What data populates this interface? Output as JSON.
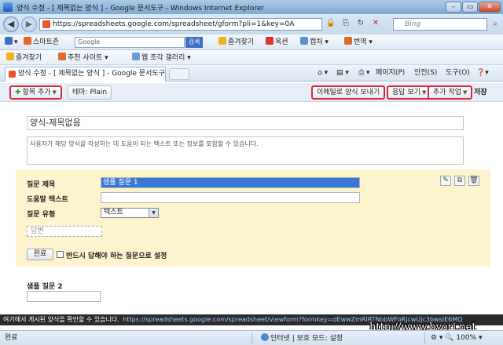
{
  "window": {
    "title": "양식 수정 - [ 제목없는 양식 ] - Google 문서도구 - Windows Internet Explorer",
    "min": "–",
    "max": "▭",
    "close": "✕"
  },
  "address": {
    "url": "https://spreadsheets.google.com/spreadsheet/gform?pli=1&key=0A",
    "search_placeholder": "Bing"
  },
  "google_toolbar": {
    "smartzone": "스마트존",
    "search_value": "Google",
    "search_button": "검색",
    "bookmarks": "즐겨찾기",
    "extras": "옥션",
    "capture": "캡처",
    "translate": "번역"
  },
  "favorites": {
    "favorites": "즐겨찾기",
    "suggested": "추천 사이트",
    "gallery": "웹 조각 갤러리"
  },
  "tabs": {
    "active": "양식 수정 - [ 제목없는 양식 ] - Google 문서도구",
    "page_menu": "페이지(P)",
    "safety_menu": "안전(S)",
    "tools_menu": "도구(O)"
  },
  "app_toolbar": {
    "add_item": "항목 추가",
    "theme": "테마: Plain",
    "email_form": "이메일로 양식 보내기",
    "view_responses": "응답 보기",
    "more_actions": "추가 작업",
    "save": "저장"
  },
  "form": {
    "title": "양식-제목없음",
    "description": "사용자가 해당 양식을 작성하는 데 도움이 되는 텍스트 또는 정보를 포함할 수 있습니다.",
    "question": {
      "title_label": "질문 제목",
      "title_value": "샘플 질문 1",
      "help_label": "도움말 텍스트",
      "type_label": "질문 유형",
      "type_value": "텍스트",
      "answer_placeholder": "답변",
      "done_button": "완료",
      "required_label": "반드시 답해야 하는 질문으로 설정"
    },
    "question2_title": "샘플 질문 2"
  },
  "link_bar": {
    "text": "여기에서 게시된 양식을 확인할 수 있습니다.",
    "url": "https://spreadsheets.google.com/spreadsheet/viewform?formkey=dEwwZmRlRTNobWFoRjcwUjc3bwsIE6MQ"
  },
  "watermark": "http://www.byori.net",
  "status": {
    "left": "완료",
    "zone": "인터넷 | 보호 모드: 설정",
    "zoom": "100%"
  },
  "colors": {
    "highlight": "#e0263a",
    "question_panel": "#fdf3cc",
    "selected_input": "#3a78d8"
  }
}
